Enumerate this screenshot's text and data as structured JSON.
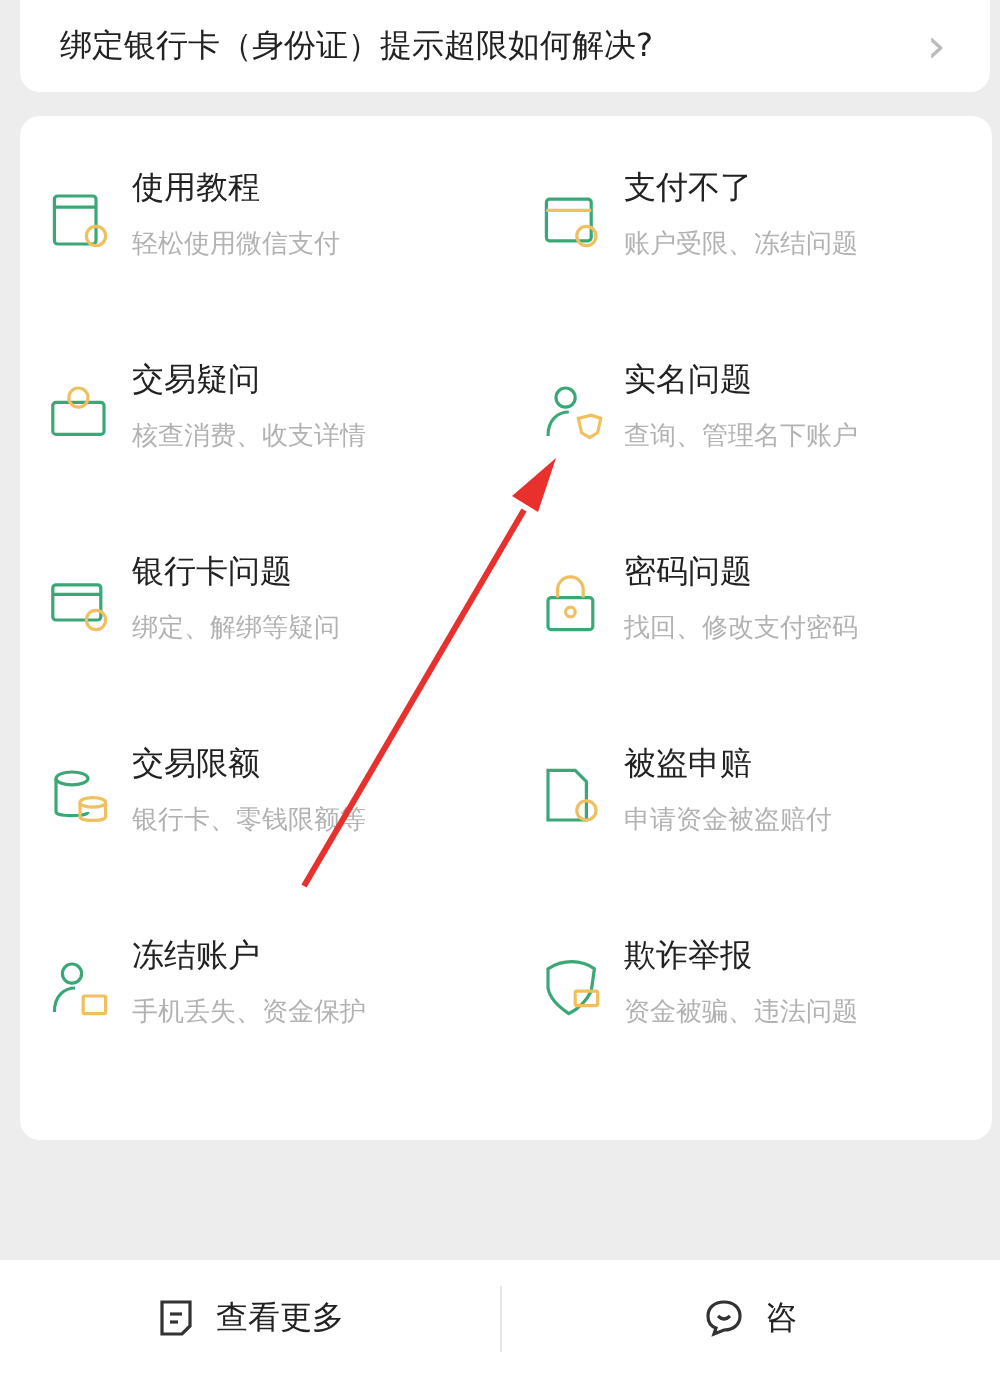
{
  "faq": {
    "question": "绑定银行卡（身份证）提示超限如何解决?",
    "chevron": "›"
  },
  "topics": [
    {
      "title": "使用教程",
      "subtitle": "轻松使用微信支付"
    },
    {
      "title": "支付不了",
      "subtitle": "账户受限、冻结问题"
    },
    {
      "title": "交易疑问",
      "subtitle": "核查消费、收支详情"
    },
    {
      "title": "实名问题",
      "subtitle": "查询、管理名下账户"
    },
    {
      "title": "银行卡问题",
      "subtitle": "绑定、解绑等疑问"
    },
    {
      "title": "密码问题",
      "subtitle": "找回、修改支付密码"
    },
    {
      "title": "交易限额",
      "subtitle": "银行卡、零钱限额等"
    },
    {
      "title": "被盗申赔",
      "subtitle": "申请资金被盗赔付"
    },
    {
      "title": "冻结账户",
      "subtitle": "手机丢失、资金保护"
    },
    {
      "title": "欺诈举报",
      "subtitle": "资金被骗、违法问题"
    }
  ],
  "bottom_bar": [
    {
      "label": "查看更多"
    },
    {
      "label": "咨"
    }
  ]
}
